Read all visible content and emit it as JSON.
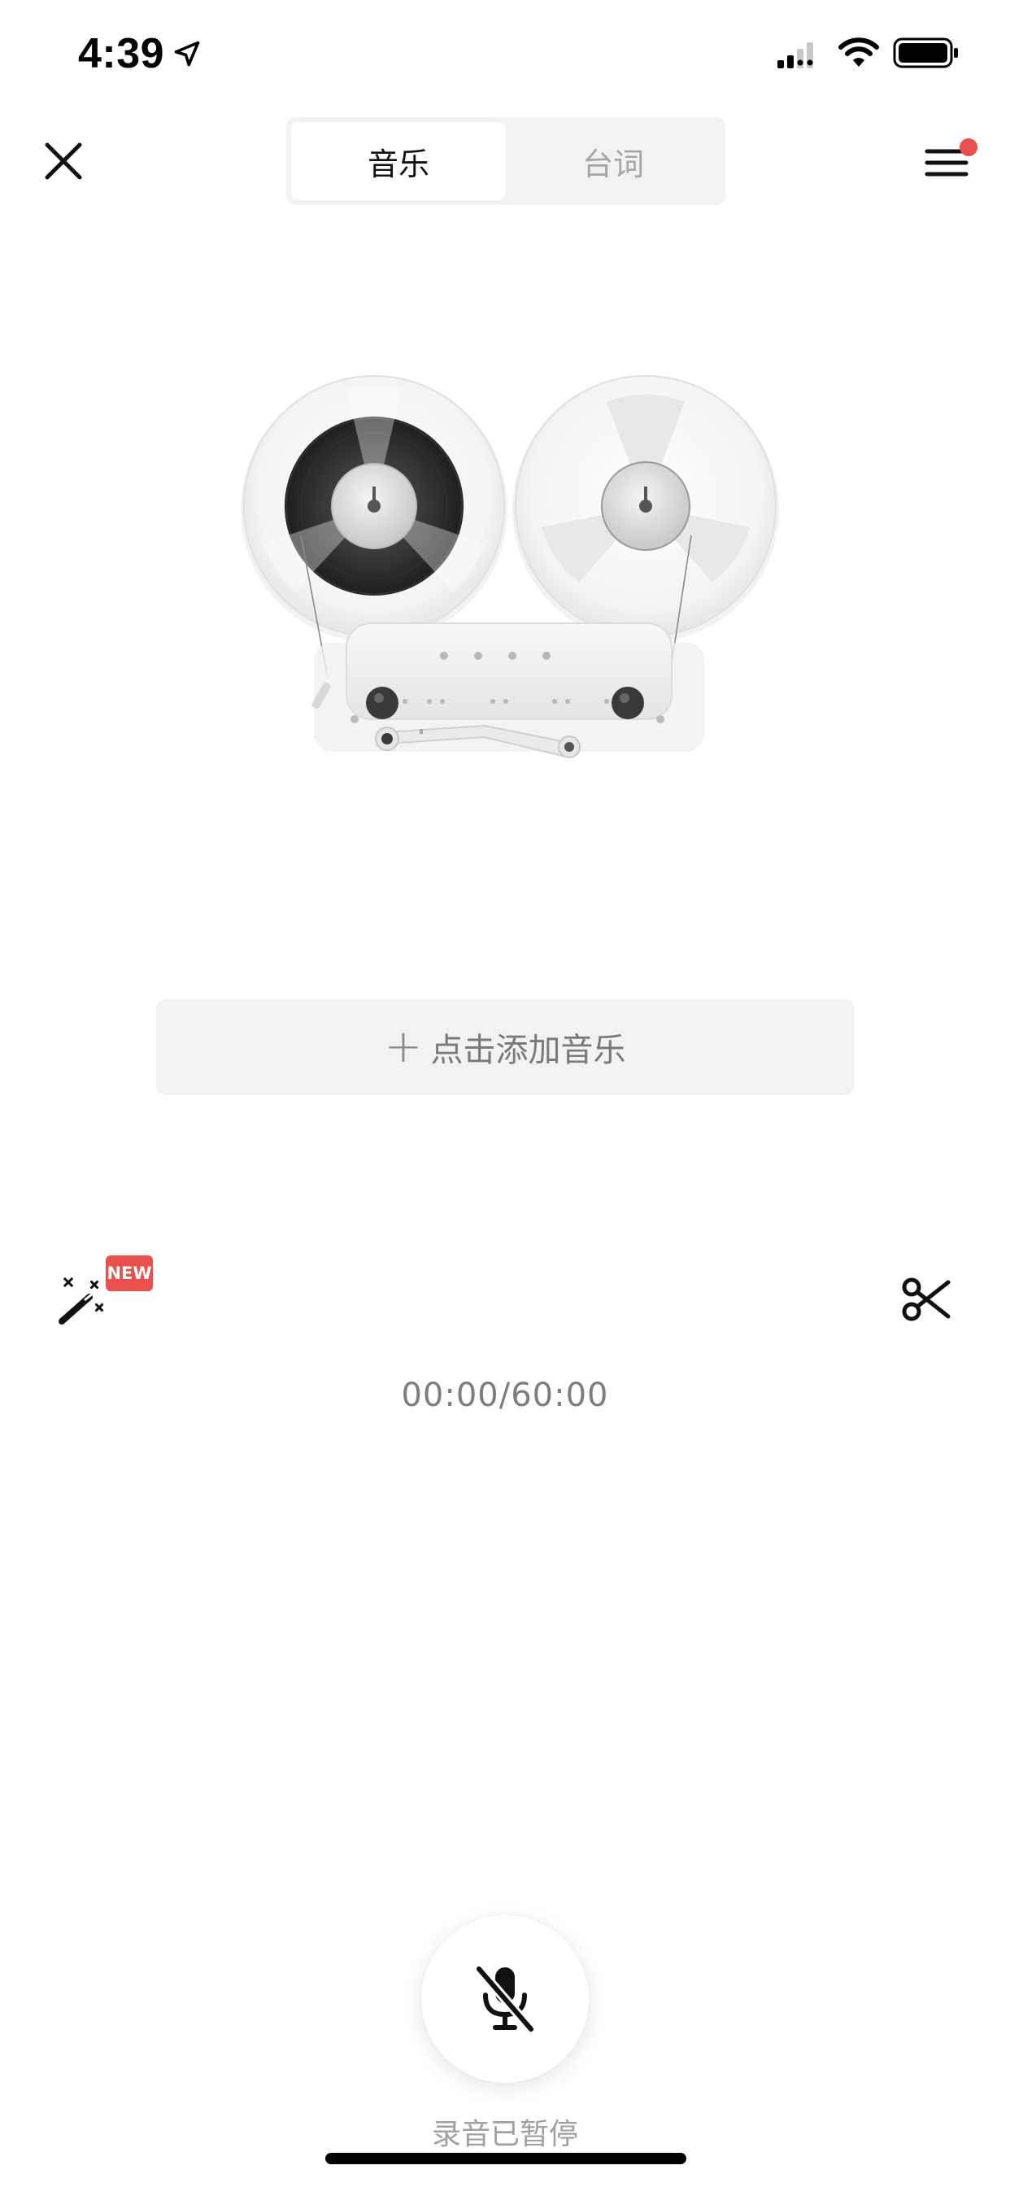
{
  "status_bar": {
    "time": "4:39",
    "icons": [
      "location-arrow-icon",
      "cellular-signal-icon",
      "wifi-icon",
      "battery-icon"
    ]
  },
  "nav": {
    "close_icon": "close-icon",
    "tabs": [
      {
        "label": "音乐",
        "active": true
      },
      {
        "label": "台词",
        "active": false
      }
    ],
    "menu_icon": "hamburger-menu-icon",
    "menu_has_notification": true
  },
  "illustration": "reel-to-reel-tape-recorder",
  "add_music": {
    "plus": "+",
    "label": "点击添加音乐"
  },
  "tools": {
    "magic_icon": "magic-wand-icon",
    "new_badge": "NEW",
    "scissors_icon": "scissors-icon"
  },
  "timer": "00:00/60:00",
  "record": {
    "icon": "microphone-muted-icon",
    "status": "录音已暂停"
  },
  "colors": {
    "accent_red": "#e9504d",
    "segment_bg": "#f2f2f2",
    "muted_text": "#7d7d7d"
  }
}
